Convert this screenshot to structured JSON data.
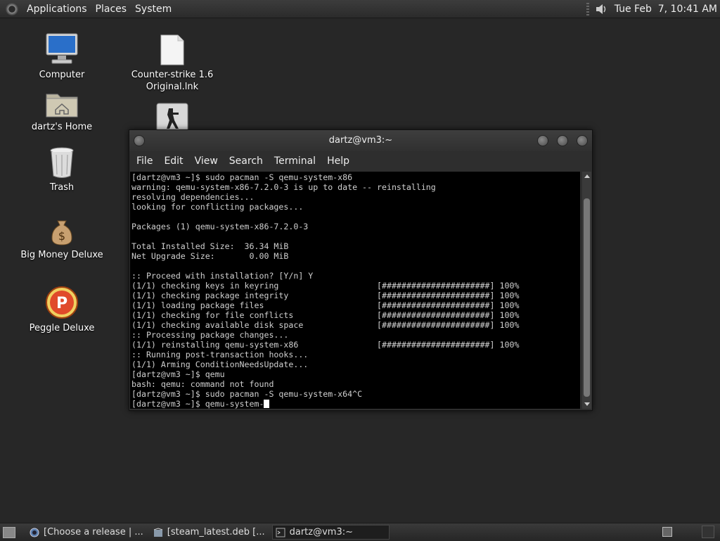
{
  "top_panel": {
    "menus": [
      "Applications",
      "Places",
      "System"
    ],
    "clock": "Tue Feb  7, 10:41 AM"
  },
  "desktop": {
    "icons": [
      {
        "label": "Computer",
        "icon": "computer-icon"
      },
      {
        "label": "dartz's Home",
        "icon": "home-folder-icon"
      },
      {
        "label": "Trash",
        "icon": "trash-icon"
      },
      {
        "label": "Big Money Deluxe",
        "icon": "money-bag-icon"
      },
      {
        "label": "Peggle Deluxe",
        "icon": "peggle-icon"
      },
      {
        "label": "Counter-strike 1.6\nOriginal.lnk",
        "icon": "file-icon"
      },
      {
        "label": "",
        "icon": "counter-strike-icon"
      }
    ]
  },
  "terminal": {
    "title": "dartz@vm3:~",
    "menus": [
      "File",
      "Edit",
      "View",
      "Search",
      "Terminal",
      "Help"
    ],
    "lines": [
      "[dartz@vm3 ~]$ sudo pacman -S qemu-system-x86",
      "warning: qemu-system-x86-7.2.0-3 is up to date -- reinstalling",
      "resolving dependencies...",
      "looking for conflicting packages...",
      "",
      "Packages (1) qemu-system-x86-7.2.0-3",
      "",
      "Total Installed Size:  36.34 MiB",
      "Net Upgrade Size:       0.00 MiB",
      "",
      ":: Proceed with installation? [Y/n] Y",
      "(1/1) checking keys in keyring                    [######################] 100%",
      "(1/1) checking package integrity                  [######################] 100%",
      "(1/1) loading package files                       [######################] 100%",
      "(1/1) checking for file conflicts                 [######################] 100%",
      "(1/1) checking available disk space               [######################] 100%",
      ":: Processing package changes...",
      "(1/1) reinstalling qemu-system-x86                [######################] 100%",
      ":: Running post-transaction hooks...",
      "(1/1) Arming ConditionNeedsUpdate...",
      "[dartz@vm3 ~]$ qemu",
      "bash: qemu: command not found",
      "[dartz@vm3 ~]$ sudo pacman -S qemu-system-x64^C"
    ],
    "prompt_line": "[dartz@vm3 ~]$ qemu-system-"
  },
  "taskbar": {
    "tasks": [
      {
        "label": "[Choose a release | ...",
        "icon": "browser-icon",
        "active": false
      },
      {
        "label": "[steam_latest.deb [...",
        "icon": "package-icon",
        "active": false
      },
      {
        "label": "dartz@vm3:~",
        "icon": "terminal-icon",
        "active": true
      }
    ]
  }
}
